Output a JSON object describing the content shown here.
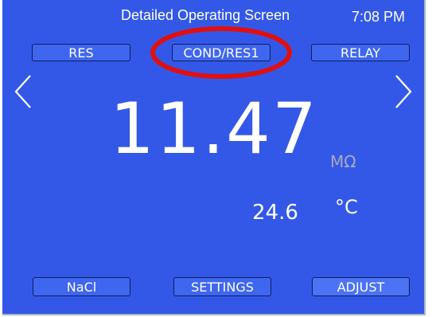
{
  "header": {
    "title": "Detailed Operating Screen",
    "time": "7:08 PM"
  },
  "tabs": [
    {
      "label": "RES"
    },
    {
      "label": "COND/RES1"
    },
    {
      "label": "RELAY"
    }
  ],
  "navigation": {
    "left_icon": "chevron-left-icon",
    "right_icon": "chevron-right-icon"
  },
  "reading": {
    "value": "11.47",
    "unit": "MΩ",
    "temperature": "24.6",
    "temperature_unit": "°C"
  },
  "footer": {
    "buttons": [
      {
        "label": "NaCl"
      },
      {
        "label": "SETTINGS"
      },
      {
        "label": "ADJUST"
      }
    ]
  },
  "annotation": {
    "highlight_color": "#e01010"
  },
  "colors": {
    "screen_background": "#3358e8",
    "button_background": "#3f66ee",
    "button_border": "#0d1d5c",
    "text": "#ffffff",
    "unit_text": "#a7aac2"
  }
}
